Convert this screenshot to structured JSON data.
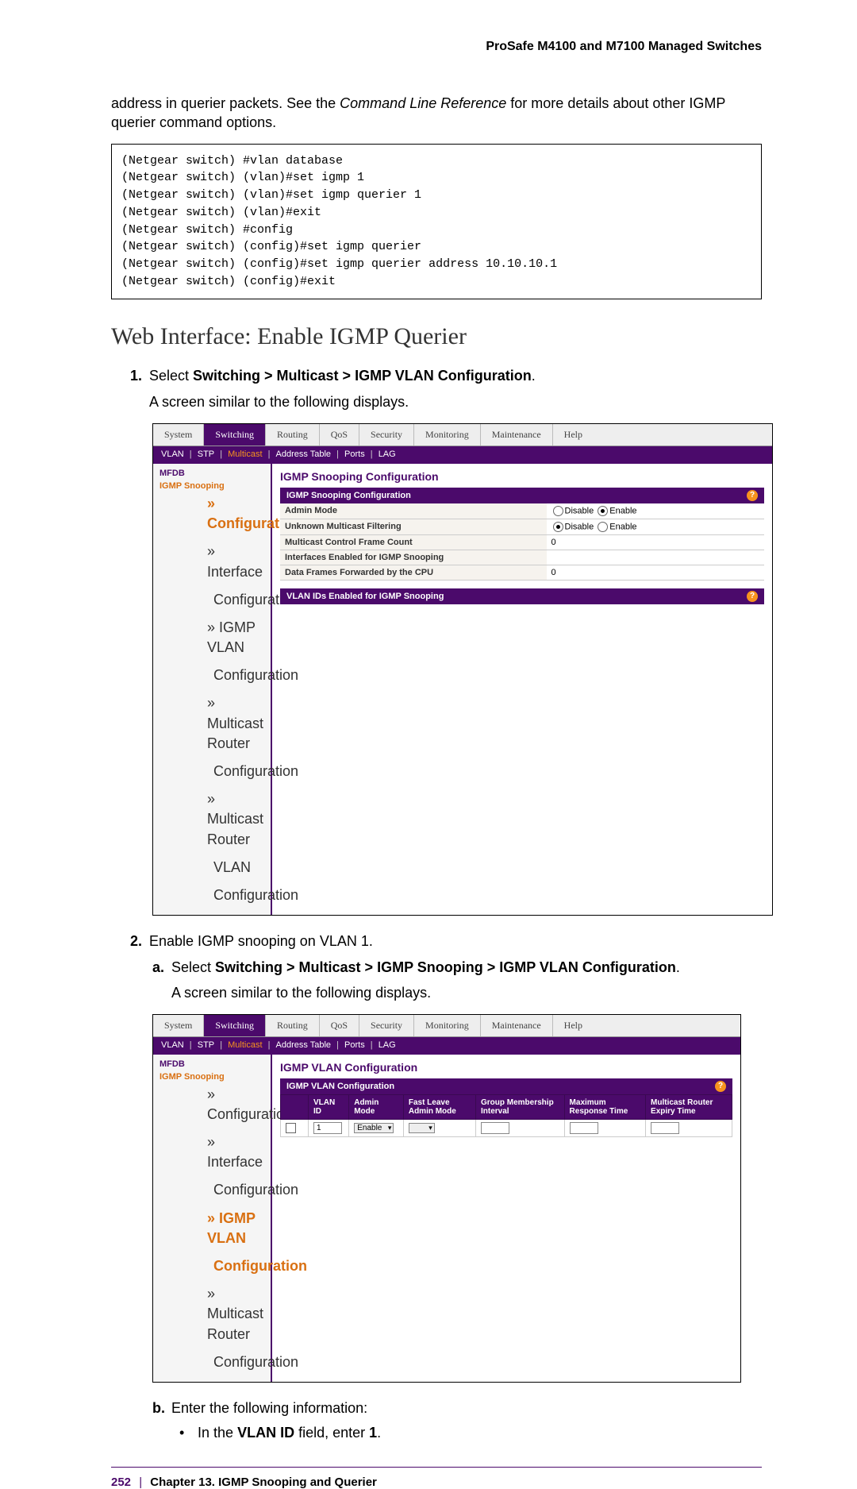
{
  "header": "ProSafe M4100 and M7100 Managed Switches",
  "para1_a": "address in querier packets. See the ",
  "para1_ital": "Command Line Reference",
  "para1_b": " for more details about other IGMP querier command options.",
  "code": "(Netgear switch) #vlan database\n(Netgear switch) (vlan)#set igmp 1\n(Netgear switch) (vlan)#set igmp querier 1\n(Netgear switch) (vlan)#exit\n(Netgear switch) #config\n(Netgear switch) (config)#set igmp querier\n(Netgear switch) (config)#set igmp querier address 10.10.10.1\n(Netgear switch) (config)#exit",
  "h2": "Web Interface: Enable IGMP Querier",
  "step1_num": "1.",
  "step1_a": "Select ",
  "step1_b": "Switching > Multicast > IGMP VLAN Configuration",
  "step1_c": ".",
  "step1_sub": "A screen similar to the following displays.",
  "step2_num": "2.",
  "step2_text": "Enable IGMP snooping on VLAN 1.",
  "sub_a_letter": "a.",
  "sub_a_a": "Select ",
  "sub_a_b": "Switching > Multicast > IGMP Snooping > IGMP VLAN Configuration",
  "sub_a_c": ".",
  "sub_a_sub": "A screen similar to the following displays.",
  "sub_b_letter": "b.",
  "sub_b_text": "Enter the following information:",
  "bullet1_a": "In the ",
  "bullet1_b": "VLAN ID",
  "bullet1_c": " field, enter ",
  "bullet1_d": "1",
  "bullet1_e": ".",
  "footer_page": "252",
  "footer_sep": "|",
  "footer_text": "Chapter 13.  IGMP Snooping and Querier",
  "ui": {
    "tabs": [
      "System",
      "Switching",
      "Routing",
      "QoS",
      "Security",
      "Monitoring",
      "Maintenance",
      "Help"
    ],
    "subtabs": [
      "VLAN",
      "STP",
      "Multicast",
      "Address Table",
      "Ports",
      "LAG"
    ],
    "side": {
      "mfdb": "MFDB",
      "igmp": "IGMP Snooping",
      "cfg": "Configuration",
      "ifcfg": "Interface",
      "ifcfg2": "Configuration",
      "ivlan": "IGMP VLAN",
      "ivlan2": "Configuration",
      "mrouter": "Multicast Router",
      "mrouter2": "Configuration",
      "mroutervlan": "Multicast Router",
      "mroutervlan2": "VLAN",
      "mroutervlan3": "Configuration"
    },
    "screen1": {
      "title": "IGMP Snooping Configuration",
      "sec1_title": "IGMP Snooping Configuration",
      "rows": {
        "admin_mode": "Admin Mode",
        "umf": "Unknown Multicast Filtering",
        "mcfc": "Multicast Control Frame Count",
        "mcfc_val": "0",
        "ies": "Interfaces Enabled for IGMP Snooping",
        "dff": "Data Frames Forwarded by the CPU",
        "dff_val": "0"
      },
      "radios": {
        "disable": "Disable",
        "enable": "Enable"
      },
      "sec2_title": "VLAN IDs Enabled for IGMP Snooping"
    },
    "screen2": {
      "title": "IGMP VLAN Configuration",
      "sec_title": "IGMP VLAN Configuration",
      "th": {
        "vlanid": "VLAN ID",
        "admin": "Admin Mode",
        "fast": "Fast Leave Admin Mode",
        "group": "Group Membership Interval",
        "max": "Maximum Response Time",
        "expiry": "Multicast Router Expiry Time"
      },
      "row": {
        "vlanid": "1",
        "admin": "Enable"
      }
    }
  }
}
